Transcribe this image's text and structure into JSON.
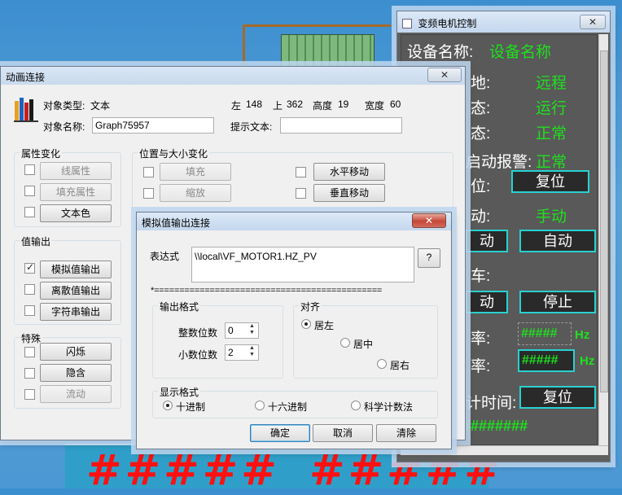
{
  "background": {
    "hash_rows": [
      "#####",
      "#####"
    ]
  },
  "main_dialog": {
    "title": "动画连接",
    "object_type_label": "对象类型:",
    "object_type_value": "文本",
    "left_label": "左",
    "left_value": "148",
    "top_label": "上",
    "top_value": "362",
    "height_label": "高度",
    "height_value": "19",
    "width_label": "宽度",
    "width_value": "60",
    "object_name_label": "对象名称:",
    "object_name_value": "Graph75957",
    "hint_label": "提示文本:",
    "hint_value": "",
    "group_attr": "属性变化",
    "btn_line_attr": "线属性",
    "btn_fill_attr": "填充属性",
    "btn_text_color": "文本色",
    "group_position": "位置与大小变化",
    "btn_fill": "填充",
    "btn_scale": "缩放",
    "btn_hmove": "水平移动",
    "btn_vmove": "垂直移动",
    "group_value_out": "值输出",
    "btn_analog_out": "模拟值输出",
    "btn_discrete_out": "离散值输出",
    "btn_string_out": "字符串输出",
    "group_special": "特殊",
    "btn_flash": "闪烁",
    "btn_hide": "隐含",
    "btn_flow": "流动"
  },
  "analog_dialog": {
    "title": "模拟值输出连接",
    "expr_label": "表达式",
    "expr_value": "\\\\local\\VF_MOTOR1.HZ_PV",
    "help_btn": "?",
    "separator": "*=============================================",
    "output_format_group": "输出格式",
    "int_digits_label": "整数位数",
    "int_digits_value": "0",
    "dec_digits_label": "小数位数",
    "dec_digits_value": "2",
    "align_group": "对齐",
    "align_left": "居左",
    "align_center": "居中",
    "align_right": "居右",
    "display_group": "显示格式",
    "fmt_decimal": "十进制",
    "fmt_hex": "十六进制",
    "fmt_sci": "科学计数法",
    "ok_btn": "确定",
    "cancel_btn": "取消",
    "clear_btn": "清除"
  },
  "right_panel": {
    "title": "变频电机控制",
    "device_name_label": "设备名称:",
    "device_name_value": "设备名称",
    "row2_label": "地:",
    "row2_value": "远程",
    "row3_label": "态:",
    "row3_value": "运行",
    "row4_label": "态:",
    "row4_value": "正常",
    "row5_label": "启动报警:",
    "row5_value": "正常",
    "row6_label": "位:",
    "reset_btn_1": "复位",
    "row7_label": "动:",
    "row7_value": "手动",
    "manual_btn": "动",
    "auto_btn": "自动",
    "row9_label": "车:",
    "manual_btn_2": "动",
    "stop_btn": "停止",
    "row11_label": "率:",
    "freq_display_1": "#####",
    "freq_unit_1": "Hz",
    "row12_label": "率:",
    "freq_display_2": "#####",
    "freq_unit_2": "Hz",
    "row13_label": "计时间:",
    "reset_btn_2": "复位",
    "bottom_hash": "########"
  }
}
